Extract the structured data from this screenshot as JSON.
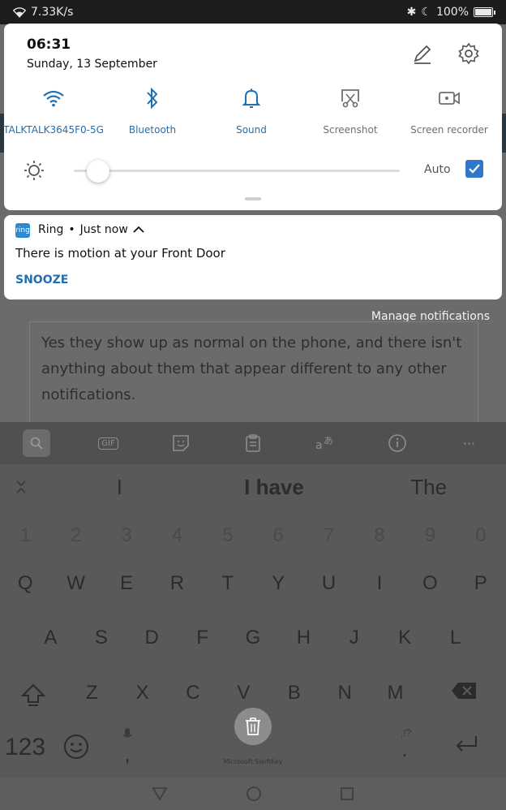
{
  "status_bar": {
    "speed": "7.33K/s",
    "battery": "100%",
    "battery_level": 1.0
  },
  "quick_settings": {
    "time": "06:31",
    "date": "Sunday, 13 September",
    "tiles": [
      {
        "label": "TALKTALK3645F0-5G",
        "icon": "wifi-icon",
        "active": true
      },
      {
        "label": "Bluetooth",
        "icon": "bluetooth-icon",
        "active": true
      },
      {
        "label": "Sound",
        "icon": "bell-icon",
        "active": true
      },
      {
        "label": "Screenshot",
        "icon": "screenshot-icon",
        "active": false
      },
      {
        "label": "Screen recorder",
        "icon": "screen-recorder-icon",
        "active": false
      }
    ],
    "brightness": {
      "level": 0.04,
      "auto_label": "Auto",
      "auto_checked": true
    },
    "accent_color": "#1f6fb4"
  },
  "notification": {
    "app": "Ring",
    "time": "Just now",
    "message": "There is motion at your Front Door",
    "action": "SNOOZE",
    "app_icon_text": "ring"
  },
  "background": {
    "manage_notifications": "Manage notifications",
    "reply_text": "Yes they show up as normal on the phone, and there isn't anything about them that appear different to any other notifications."
  },
  "keyboard": {
    "toolbar_icons": [
      "search-icon",
      "gif-icon",
      "sticker-icon",
      "clipboard-icon",
      "translate-icon",
      "info-icon",
      "more-icon"
    ],
    "gif_label": "GIF",
    "more_label": "···",
    "suggestions": [
      "I",
      "I have",
      "The"
    ],
    "numbers": [
      "1",
      "2",
      "3",
      "4",
      "5",
      "6",
      "7",
      "8",
      "9",
      "0"
    ],
    "row1": [
      "Q",
      "W",
      "E",
      "R",
      "T",
      "Y",
      "U",
      "I",
      "O",
      "P"
    ],
    "row2": [
      "A",
      "S",
      "D",
      "F",
      "G",
      "H",
      "J",
      "K",
      "L"
    ],
    "row3": [
      "Z",
      "X",
      "C",
      "V",
      "B",
      "N",
      "M"
    ],
    "symbols_key": "123",
    "comma": ",",
    "period": ".",
    "punct_hint": ",!?",
    "brand": "Microsoft SwiftKey"
  }
}
